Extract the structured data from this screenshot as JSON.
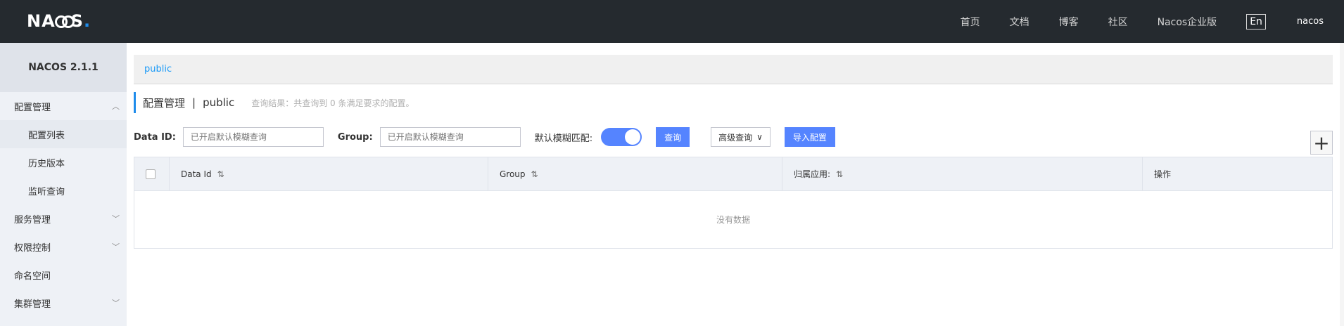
{
  "topbar": {
    "logo_text": "NACOS.",
    "nav": [
      "首页",
      "文档",
      "博客",
      "社区",
      "Nacos企业版"
    ],
    "lang_label": "En",
    "user": "nacos"
  },
  "sidebar": {
    "version": "NACOS 2.1.1",
    "items": [
      {
        "label": "配置管理"
      },
      {
        "label": "配置列表"
      },
      {
        "label": "历史版本"
      },
      {
        "label": "监听查询"
      },
      {
        "label": "服务管理"
      },
      {
        "label": "权限控制"
      },
      {
        "label": "命名空间"
      },
      {
        "label": "集群管理"
      }
    ]
  },
  "breadcrumb": {
    "namespace": "public"
  },
  "title": {
    "section": "配置管理",
    "separator": "|",
    "namespace": "public",
    "summary": "查询结果：共查询到 0 条满足要求的配置。"
  },
  "filters": {
    "dataid_label": "Data ID:",
    "dataid_placeholder": "已开启默认模糊查询",
    "group_label": "Group:",
    "group_placeholder": "已开启默认模糊查询",
    "fuzzy_label": "默认模糊匹配:",
    "search_label": "查询",
    "advanced_label": "高级查询",
    "import_label": "导入配置"
  },
  "table": {
    "headers": [
      "Data Id",
      "Group",
      "归属应用:",
      "操作"
    ],
    "empty_text": "没有数据"
  },
  "colors": {
    "topbar_bg": "#252a2f",
    "accent": "#5584ff",
    "link": "#1b9af7",
    "sidebar_bg": "#eef1f6"
  }
}
